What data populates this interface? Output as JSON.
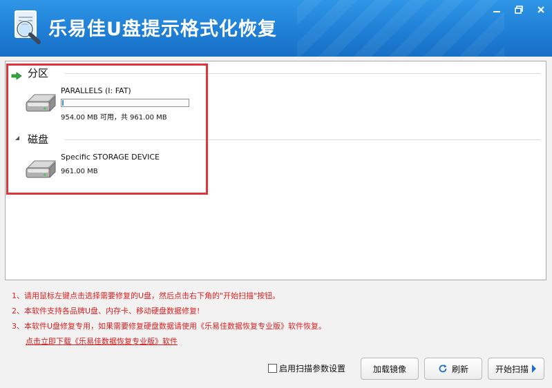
{
  "window": {
    "title": "乐易佳U盘提示格式化恢复",
    "icons": [
      "app-logo-icon",
      "minimize-icon",
      "restore-icon",
      "close-icon"
    ]
  },
  "sections": {
    "partition": {
      "label": "分区",
      "devices": [
        {
          "name": "PARALLELS (I: FAT)",
          "free": "954.00 MB 可用，共 961.00 MB",
          "usage_percent": 1
        }
      ]
    },
    "disk": {
      "label": "磁盘",
      "devices": [
        {
          "name": "Specific STORAGE DEVICE",
          "size": "961.00 MB"
        }
      ]
    }
  },
  "info": {
    "lines": [
      "1、请用鼠标左键点击选择需要修复的U盘，然后点击右下角的\"开始扫描\"按钮。",
      "2、本软件支持各品牌U盘、内存卡、移动硬盘数据修复!",
      "3、本软件U盘修复专用，如果需要修复硬盘数据请使用《乐易佳数据恢复专业版》软件恢复。"
    ],
    "link": "点击立即下载《乐易佳数据恢复专业版》软件"
  },
  "controls": {
    "scan_settings": "启用扫描参数设置",
    "load_image": "加载镜像",
    "refresh": "刷新",
    "start_scan": "开始扫描"
  },
  "colors": {
    "titlebar": "#1f7fd6",
    "highlight": "#e0343a",
    "info_text": "#e01f1f",
    "progress": "#3a8fd6"
  }
}
